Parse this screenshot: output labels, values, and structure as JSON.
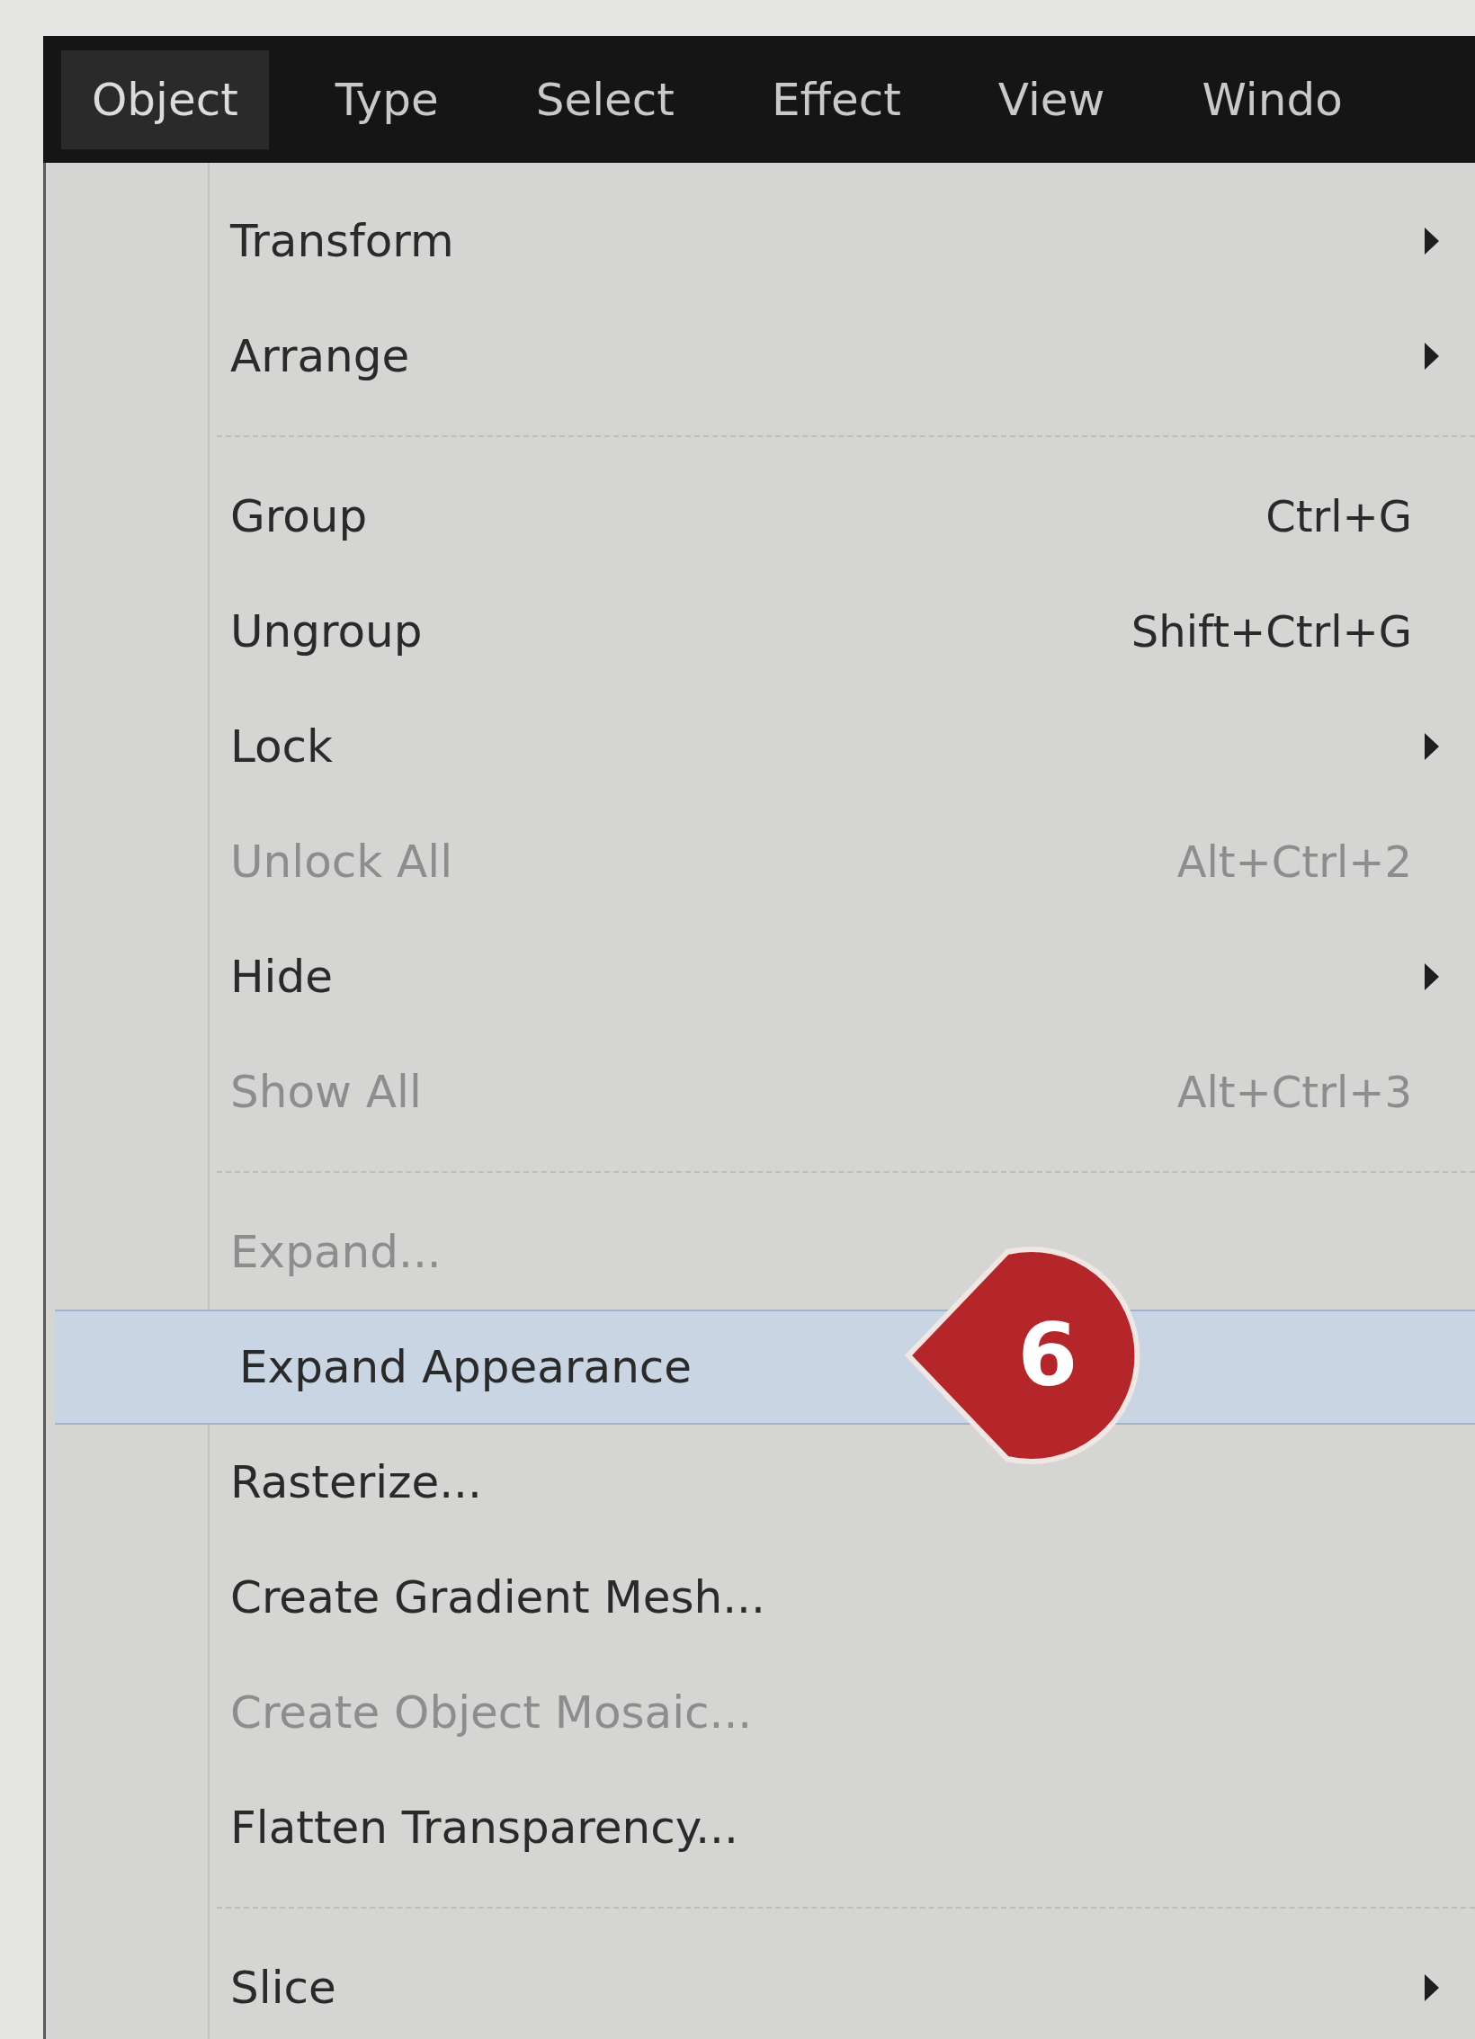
{
  "menu_bar": [
    {
      "label": "Object",
      "selected": true
    },
    {
      "label": "Type",
      "selected": false
    },
    {
      "label": "Select",
      "selected": false
    },
    {
      "label": "Effect",
      "selected": false
    },
    {
      "label": "View",
      "selected": false
    },
    {
      "label": "Windo",
      "selected": false
    }
  ],
  "menu": [
    {
      "kind": "item",
      "label": "Transform",
      "submenu": true,
      "disabled": false,
      "selected": false
    },
    {
      "kind": "item",
      "label": "Arrange",
      "submenu": true,
      "disabled": false,
      "selected": false
    },
    {
      "kind": "separator"
    },
    {
      "kind": "item",
      "label": "Group",
      "shortcut": "Ctrl+G",
      "submenu": false,
      "disabled": false,
      "selected": false
    },
    {
      "kind": "item",
      "label": "Ungroup",
      "shortcut": "Shift+Ctrl+G",
      "submenu": false,
      "disabled": false,
      "selected": false
    },
    {
      "kind": "item",
      "label": "Lock",
      "submenu": true,
      "disabled": false,
      "selected": false
    },
    {
      "kind": "item",
      "label": "Unlock All",
      "shortcut": "Alt+Ctrl+2",
      "submenu": false,
      "disabled": true,
      "selected": false
    },
    {
      "kind": "item",
      "label": "Hide",
      "submenu": true,
      "disabled": false,
      "selected": false
    },
    {
      "kind": "item",
      "label": "Show All",
      "shortcut": "Alt+Ctrl+3",
      "submenu": false,
      "disabled": true,
      "selected": false
    },
    {
      "kind": "separator"
    },
    {
      "kind": "item",
      "label": "Expand...",
      "submenu": false,
      "disabled": true,
      "selected": false
    },
    {
      "kind": "item",
      "label": "Expand Appearance",
      "submenu": false,
      "disabled": false,
      "selected": true
    },
    {
      "kind": "item",
      "label": "Rasterize...",
      "submenu": false,
      "disabled": false,
      "selected": false
    },
    {
      "kind": "item",
      "label": "Create Gradient Mesh...",
      "submenu": false,
      "disabled": false,
      "selected": false
    },
    {
      "kind": "item",
      "label": "Create Object Mosaic...",
      "submenu": false,
      "disabled": true,
      "selected": false
    },
    {
      "kind": "item",
      "label": "Flatten Transparency...",
      "submenu": false,
      "disabled": false,
      "selected": false
    },
    {
      "kind": "separator"
    },
    {
      "kind": "item",
      "label": "Slice",
      "submenu": true,
      "disabled": false,
      "selected": false
    }
  ],
  "callout": "6"
}
